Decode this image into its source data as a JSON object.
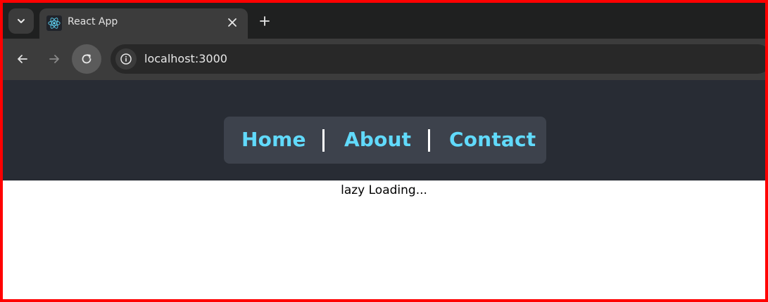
{
  "browser": {
    "tab": {
      "title": "React App",
      "favicon": "react-logo-icon"
    },
    "new_tab_icon": "plus-icon",
    "tab_search_icon": "chevron-down-icon",
    "address": "localhost:3000",
    "site_info_icon": "info-icon"
  },
  "nav": {
    "links": [
      {
        "label": "Home"
      },
      {
        "label": "About"
      },
      {
        "label": "Contact"
      }
    ]
  },
  "content": {
    "loading_text": "lazy Loading..."
  },
  "colors": {
    "header_bg": "#282c34",
    "nav_bg": "#3d424c",
    "link": "#61dafb",
    "frame_border": "#ff0000"
  }
}
